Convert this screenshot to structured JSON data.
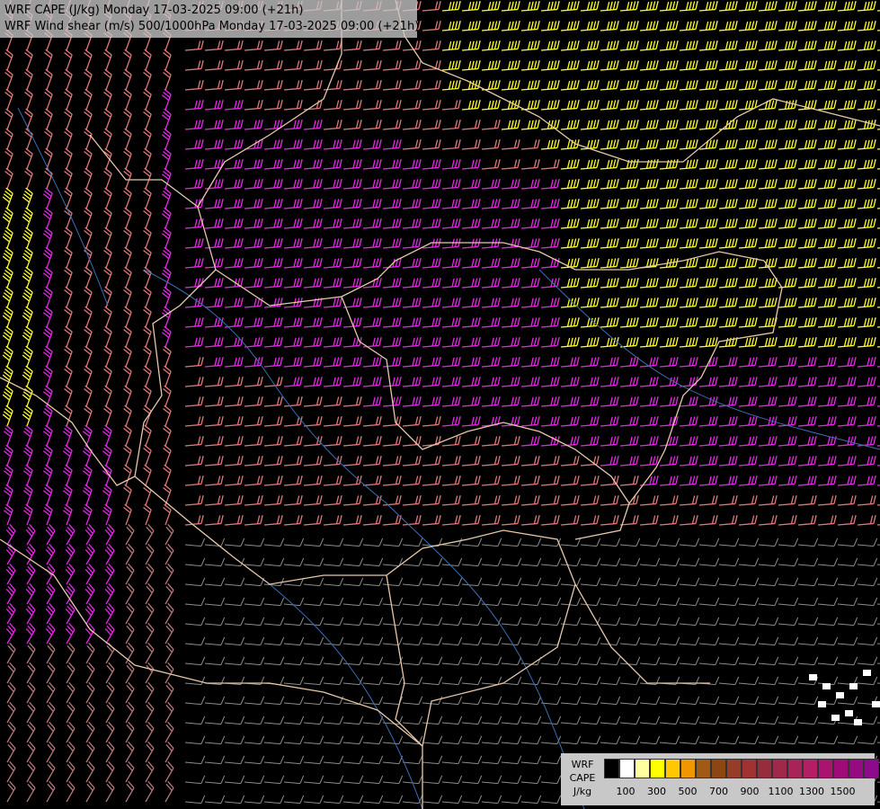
{
  "header": {
    "line1": "WRF CAPE (J/kg) Monday 17-03-2025 09:00 (+21h)",
    "line2": "WRF Wind shear (m/s) 500/1000hPa Monday 17-03-2025 09:00 (+21h)"
  },
  "legend": {
    "label_lines": [
      "WRF",
      "CAPE",
      "J/kg"
    ],
    "swatch_colors": [
      "#000000",
      "#ffffff",
      "#ffffa0",
      "#ffff00",
      "#ffc800",
      "#f09600",
      "#a05a14",
      "#8c4614",
      "#963c28",
      "#a03232",
      "#962d3c",
      "#a0284b",
      "#aa2358",
      "#b41e64",
      "#aa1470",
      "#a00a78",
      "#960a82",
      "#8c0a8c"
    ],
    "tick_labels": [
      "100",
      "300",
      "500",
      "700",
      "900",
      "1100",
      "1300",
      "1500"
    ]
  },
  "map": {
    "background_color": "#000000",
    "border_color": "#e6c8aa",
    "river_color": "#3c6eb4",
    "barb_colors": {
      "weak": "#8c8c8c",
      "low": "#b47878",
      "moderate": "#e07878",
      "strong": "#e628e6",
      "very_strong": "#ffff28"
    }
  }
}
